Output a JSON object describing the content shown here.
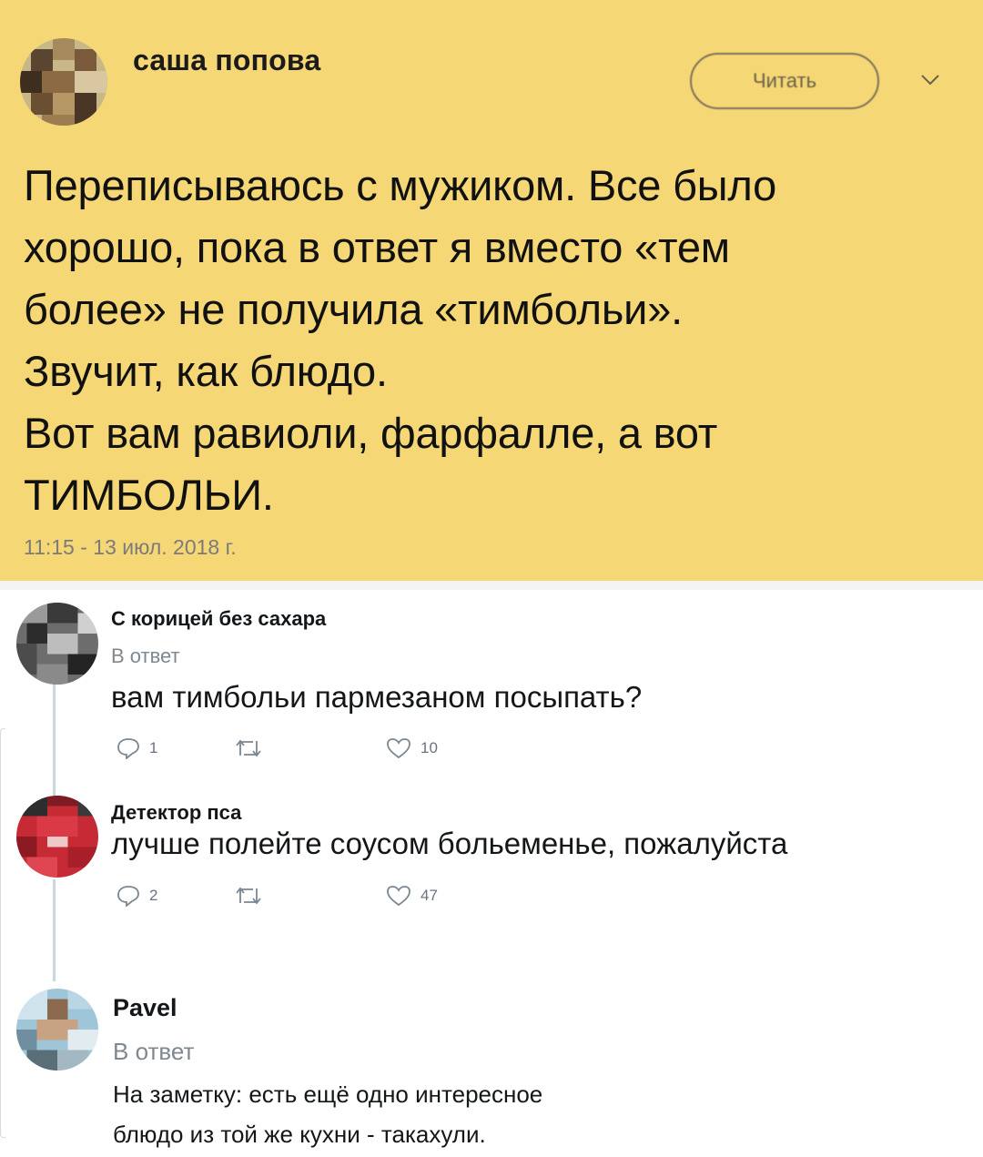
{
  "main_tweet": {
    "author": "саша попова",
    "follow_label": "Читать",
    "text": "Переписываюсь с мужиком. Все было\nхорошо, пока в ответ я вместо «тем\nболее» не получила «тимбольи».\nЗвучит, как блюдо.\nВот вам равиоли, фарфалле, а вот\nТИМБОЛЬИ.",
    "timestamp": "11:15 - 13 июл. 2018 г.",
    "background_color": "#f5d776"
  },
  "replies": [
    {
      "name": "С корицей без сахара",
      "subtitle": "В ответ",
      "text": "вам тимбольи пармезаном посыпать?",
      "reply_count": "1",
      "retweet_count": "",
      "like_count": "10"
    },
    {
      "name": "Детектор пса",
      "text": "лучше полейте соусом больеменье, пожалуйста",
      "reply_count": "2",
      "retweet_count": "",
      "like_count": "47"
    },
    {
      "name": "Pavel",
      "subtitle": "В ответ",
      "text": "На заметку: есть ещё одно интересное\nблюдо из той же кухни - такахули."
    }
  ],
  "icons": [
    "chevron-down-icon",
    "reply-icon",
    "retweet-icon",
    "like-icon"
  ]
}
